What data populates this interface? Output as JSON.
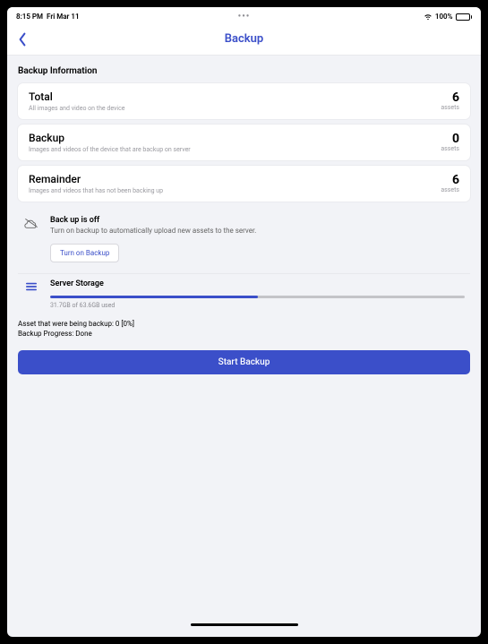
{
  "status_bar": {
    "time": "8:15 PM",
    "date": "Fri Mar 11",
    "battery_percent": "100%"
  },
  "nav": {
    "title": "Backup"
  },
  "section_title": "Backup Information",
  "cards": {
    "total": {
      "heading": "Total",
      "sub": "All images and video on the device",
      "count": "6",
      "unit": "assets"
    },
    "backup": {
      "heading": "Backup",
      "sub": "Images and videos of the device that are backup on server",
      "count": "0",
      "unit": "assets"
    },
    "remainder": {
      "heading": "Remainder",
      "sub": "Images and videos that has not been backing up",
      "count": "6",
      "unit": "assets"
    }
  },
  "notice": {
    "title": "Back up is off",
    "text": "Turn on backup to automatically upload new assets to the server.",
    "button": "Turn on Backup"
  },
  "storage": {
    "title": "Server Storage",
    "label": "31.7GB of 63.6GB used",
    "percent": 50
  },
  "info": {
    "line1": "Asset that were being backup: 0 [0%]",
    "line2": "Backup Progress: Done"
  },
  "start_button": "Start Backup"
}
